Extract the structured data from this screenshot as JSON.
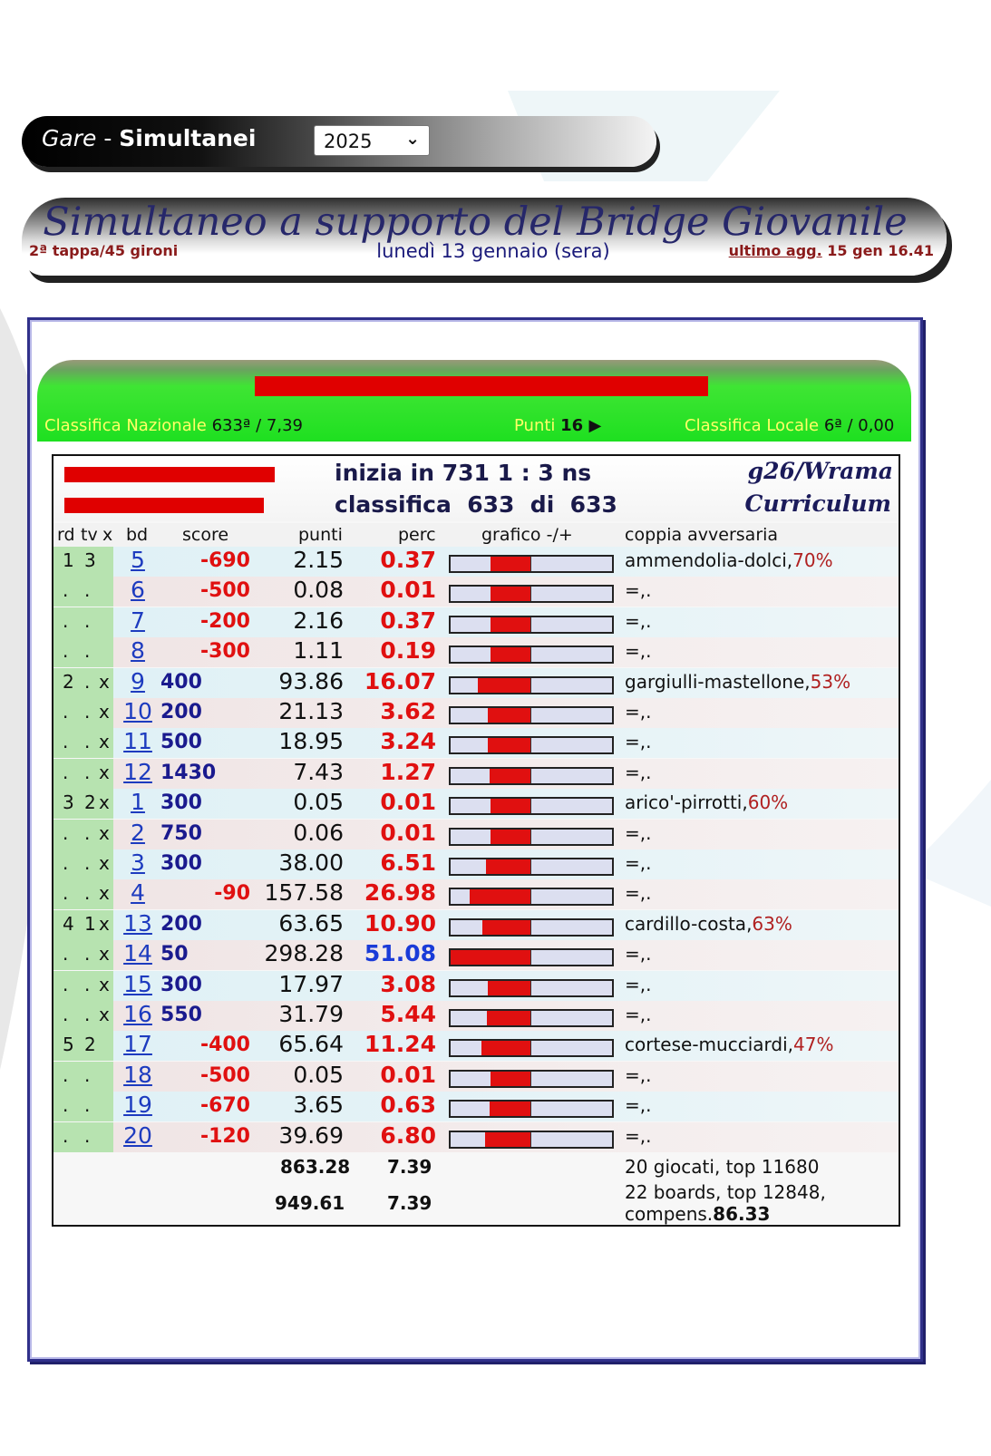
{
  "header": {
    "gare": "Gare",
    "dash": "-",
    "simultanei": "Simultanei",
    "year": "2025"
  },
  "event": {
    "title": "Simultaneo a supporto del Bridge Giovanile",
    "tappa": "2ª tappa/45 gironi",
    "date": "lunedì 13 gennaio (sera)",
    "ultimo_label": "ultimo agg.",
    "ultimo_value": "15 gen 16.41"
  },
  "player": {
    "classifica_nazionale_label": "Classifica Nazionale",
    "classifica_nazionale_value": "633ª / 7,39",
    "punti_label": "Punti",
    "punti_value": "16 ▶",
    "classifica_locale_label": "Classifica Locale",
    "classifica_locale_value": "6ª / 0,00"
  },
  "summary": {
    "inizia": "inizia in 731 1 : 3 ns",
    "classifica": "classifica  633  di  633",
    "g26": "g26/Wrama",
    "curriculum": "Curriculum"
  },
  "columns": {
    "rd": "rd",
    "tv": "tv",
    "x": "x",
    "bd": "bd",
    "score": "score",
    "punti": "punti",
    "perc": "perc",
    "grafico": "grafico -/+",
    "coppia": "coppia avversaria"
  },
  "rows": [
    {
      "rd": "1",
      "tv": "3",
      "x": "",
      "bd": "5",
      "score": "-690",
      "punti": "2.15",
      "perc": "0.37",
      "fill": 0.5,
      "opp": "ammendolia-dolci,",
      "opp_pct": "70%"
    },
    {
      "rd": ".",
      "tv": ".",
      "x": "",
      "bd": "6",
      "score": "-500",
      "punti": "0.08",
      "perc": "0.01",
      "fill": 0.5,
      "opp": "=,.",
      "opp_pct": ""
    },
    {
      "rd": ".",
      "tv": ".",
      "x": "",
      "bd": "7",
      "score": "-200",
      "punti": "2.16",
      "perc": "0.37",
      "fill": 0.5,
      "opp": "=,.",
      "opp_pct": ""
    },
    {
      "rd": ".",
      "tv": ".",
      "x": "",
      "bd": "8",
      "score": "-300",
      "punti": "1.11",
      "perc": "0.19",
      "fill": 0.5,
      "opp": "=,.",
      "opp_pct": ""
    },
    {
      "rd": "2",
      "tv": ".",
      "x": "x",
      "bd": "9",
      "score": "400",
      "punti": "93.86",
      "perc": "16.07",
      "fill": 0.34,
      "opp": "gargiulli-mastellone,",
      "opp_pct": "53%"
    },
    {
      "rd": ".",
      "tv": ".",
      "x": "x",
      "bd": "10",
      "score": "200",
      "punti": "21.13",
      "perc": "3.62",
      "fill": 0.47,
      "opp": "=,.",
      "opp_pct": ""
    },
    {
      "rd": ".",
      "tv": ".",
      "x": "x",
      "bd": "11",
      "score": "500",
      "punti": "18.95",
      "perc": "3.24",
      "fill": 0.47,
      "opp": "=,.",
      "opp_pct": ""
    },
    {
      "rd": ".",
      "tv": ".",
      "x": "x",
      "bd": "12",
      "score": "1430",
      "punti": "7.43",
      "perc": "1.27",
      "fill": 0.49,
      "opp": "=,.",
      "opp_pct": ""
    },
    {
      "rd": "3",
      "tv": "2",
      "x": "x",
      "bd": "1",
      "score": "300",
      "punti": "0.05",
      "perc": "0.01",
      "fill": 0.5,
      "opp": "arico'-pirrotti,",
      "opp_pct": "60%"
    },
    {
      "rd": ".",
      "tv": ".",
      "x": "x",
      "bd": "2",
      "score": "750",
      "punti": "0.06",
      "perc": "0.01",
      "fill": 0.5,
      "opp": "=,.",
      "opp_pct": ""
    },
    {
      "rd": ".",
      "tv": ".",
      "x": "x",
      "bd": "3",
      "score": "300",
      "punti": "38.00",
      "perc": "6.51",
      "fill": 0.44,
      "opp": "=,.",
      "opp_pct": ""
    },
    {
      "rd": ".",
      "tv": ".",
      "x": "x",
      "bd": "4",
      "score": "-90",
      "punti": "157.58",
      "perc": "26.98",
      "fill": 0.24,
      "opp": "=,.",
      "opp_pct": ""
    },
    {
      "rd": "4",
      "tv": "1",
      "x": "x",
      "bd": "13",
      "score": "200",
      "punti": "63.65",
      "perc": "10.90",
      "fill": 0.4,
      "opp": "cardillo-costa,",
      "opp_pct": "63%"
    },
    {
      "rd": ".",
      "tv": ".",
      "x": "x",
      "bd": "14",
      "score": "50",
      "punti": "298.28",
      "perc": "51.08",
      "fill": 0.0,
      "opp": "=,.",
      "opp_pct": ""
    },
    {
      "rd": ".",
      "tv": ".",
      "x": "x",
      "bd": "15",
      "score": "300",
      "punti": "17.97",
      "perc": "3.08",
      "fill": 0.47,
      "opp": "=,.",
      "opp_pct": ""
    },
    {
      "rd": ".",
      "tv": ".",
      "x": "x",
      "bd": "16",
      "score": "550",
      "punti": "31.79",
      "perc": "5.44",
      "fill": 0.45,
      "opp": "=,.",
      "opp_pct": ""
    },
    {
      "rd": "5",
      "tv": "2",
      "x": "",
      "bd": "17",
      "score": "-400",
      "punti": "65.64",
      "perc": "11.24",
      "fill": 0.39,
      "opp": "cortese-mucciardi,",
      "opp_pct": "47%"
    },
    {
      "rd": ".",
      "tv": ".",
      "x": "",
      "bd": "18",
      "score": "-500",
      "punti": "0.05",
      "perc": "0.01",
      "fill": 0.5,
      "opp": "=,.",
      "opp_pct": ""
    },
    {
      "rd": ".",
      "tv": ".",
      "x": "",
      "bd": "19",
      "score": "-670",
      "punti": "3.65",
      "perc": "0.63",
      "fill": 0.49,
      "opp": "=,.",
      "opp_pct": ""
    },
    {
      "rd": ".",
      "tv": ".",
      "x": "",
      "bd": "20",
      "score": "-120",
      "punti": "39.69",
      "perc": "6.80",
      "fill": 0.43,
      "opp": "=,.",
      "opp_pct": ""
    }
  ],
  "totals": {
    "punti1": "863.28",
    "perc1": "7.39",
    "note1": "20 giocati, top 11680",
    "punti2": "949.61",
    "perc2": "7.39",
    "note2a": "22 boards, top 12848,",
    "note2b_label": "compens.",
    "note2b_value": "86.33"
  },
  "colors": {
    "negative": "#e01010",
    "positive": "#1a1a8e",
    "link": "#1d3bbf",
    "header_green": "#1ee020",
    "accent_yellow": "#ffff66"
  }
}
